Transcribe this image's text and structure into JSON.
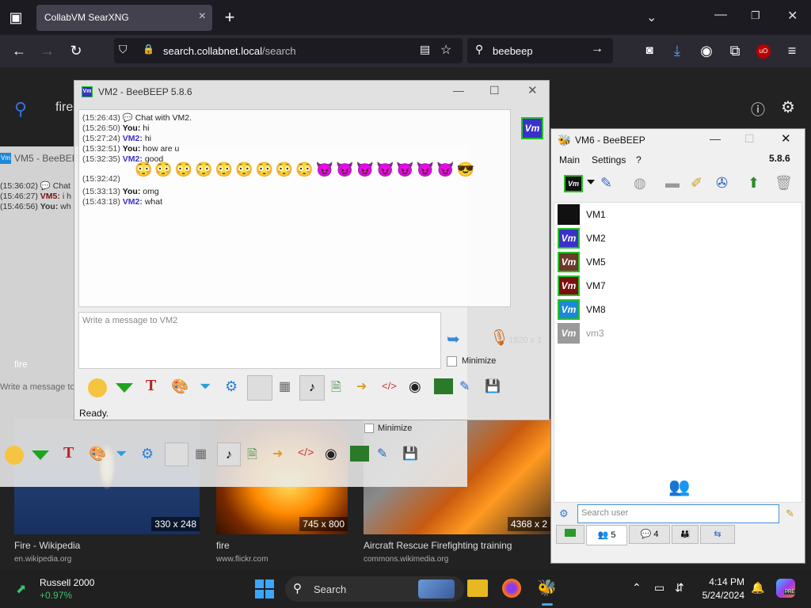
{
  "browser": {
    "tab_title": "CollabVM SearXNG",
    "url_host": "search.collabnet.local",
    "url_path": "/search",
    "search_value": "beebeep",
    "addon_badge": "uO",
    "new_tab": "+"
  },
  "page": {
    "query_partial": "fire",
    "results": [
      {
        "title": "Fire - Wikipedia",
        "site": "en.wikipedia.org",
        "dims": "330 x 248"
      },
      {
        "title": "fire",
        "site": "www.flickr.com",
        "dims": "745 x 800"
      },
      {
        "title": "Aircraft Rescue Firefighting training",
        "site": "commons.wikimedia.org",
        "dims": "4368 x 2"
      }
    ]
  },
  "vm5": {
    "title": "VM5 - BeeBEEP",
    "lines": [
      {
        "ts": "(15:36:02)",
        "who": "",
        "text": "Chat"
      },
      {
        "ts": "(15:46:27)",
        "who": "VM5:",
        "text": "i h"
      },
      {
        "ts": "(15:46:56)",
        "who": "You:",
        "text": "wh"
      }
    ],
    "placeholder": "Write a message to",
    "minimize": "Minimize",
    "fire_label": "fire"
  },
  "vm2": {
    "title": "VM2 - BeeBEEP 5.8.6",
    "badge": "Vm",
    "messages": [
      {
        "ts": "(15:26:43)",
        "who": "",
        "text": "Chat with VM2."
      },
      {
        "ts": "(15:26:50)",
        "who": "You:",
        "text": "hi"
      },
      {
        "ts": "(15:27:24)",
        "who": "VM2:",
        "text": "hi"
      },
      {
        "ts": "(15:32:51)",
        "who": "You:",
        "text": "how are u"
      },
      {
        "ts": "(15:32:35)",
        "who": "VM2:",
        "text": "good"
      },
      {
        "ts": "(15:32:42)",
        "who": "",
        "text": ""
      },
      {
        "ts": "(15:33:13)",
        "who": "You:",
        "text": "omg"
      },
      {
        "ts": "(15:43:18)",
        "who": "VM2:",
        "text": "what"
      }
    ],
    "message_placeholder": "Write a message to VM2",
    "minimize": "Minimize",
    "status": "Ready.",
    "ghost_size": "1920 x 1"
  },
  "vm6": {
    "title": "VM6 - BeeBEEP",
    "version": "5.8.6",
    "menu": [
      "Main",
      "Settings",
      "?"
    ],
    "users": [
      {
        "name": "VM1",
        "color": "#111111"
      },
      {
        "name": "VM2",
        "color": "#3a32c8"
      },
      {
        "name": "VM5",
        "color": "#6b3a2a"
      },
      {
        "name": "VM7",
        "color": "#7a1010"
      },
      {
        "name": "VM8",
        "color": "#1e88d8"
      },
      {
        "name": "vm3",
        "color": "#9a9a9a"
      }
    ],
    "badge": "Vm",
    "search_placeholder": "Search user",
    "tabs": [
      "5",
      "4"
    ]
  },
  "taskbar": {
    "ticker_name": "Russell 2000",
    "ticker_change": "+0.97%",
    "search": "Search",
    "time": "4:14 PM",
    "date": "5/24/2024",
    "pre_badge": "PRE"
  },
  "colors": {
    "accent": "#4a90d9",
    "positive": "#3ac26b",
    "vm_green_border": "#22c322"
  }
}
